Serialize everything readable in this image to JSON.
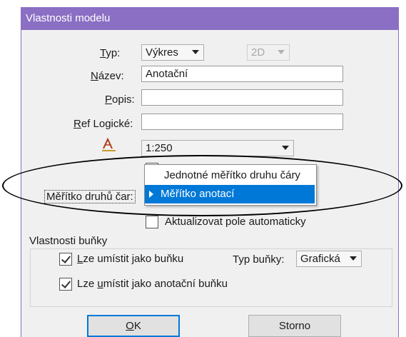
{
  "window": {
    "title": "Vlastnosti modelu"
  },
  "form": {
    "typ": {
      "label_u": "T",
      "label_rest": "yp:",
      "value": "Výkres",
      "dim_value": "2D"
    },
    "nazev": {
      "label_u": "N",
      "label_rest": "ázev:",
      "value": "Anotační"
    },
    "popis": {
      "label_u": "P",
      "label_rest": "opis:",
      "value": ""
    },
    "ref": {
      "label_u": "R",
      "label_rest": "ef Logické:",
      "value": ""
    },
    "annotation_scale": {
      "icon": "annotation-scale-icon",
      "value": "1:250"
    },
    "line_scale": {
      "label": "Měřítko druhů čar:"
    },
    "aktualizovat": {
      "label": "Aktualizovat pole automaticky",
      "checked": false
    }
  },
  "dropdown": {
    "items": [
      {
        "label": "Jednotné měřítko druhu čáry",
        "selected": false
      },
      {
        "label": "Měřítko anotací",
        "selected": true
      }
    ]
  },
  "cell_group": {
    "title": "Vlastnosti buňky",
    "place_as_cell": {
      "label_u": "L",
      "label_rest": "ze umístit jako buňku",
      "checked": true
    },
    "cell_type": {
      "label": "Typ buňky:",
      "value": "Grafická"
    },
    "place_as_annotation": {
      "label_pre": "Lze ",
      "label_u": "u",
      "label_rest": "místit jako anotační buňku",
      "checked": true
    }
  },
  "buttons": {
    "ok_u": "O",
    "ok_rest": "K",
    "cancel": "Storno"
  },
  "colors": {
    "titlebar": "#8a6fc4",
    "selection": "#0078d7",
    "dialog_bg": "#f0f0f0"
  }
}
